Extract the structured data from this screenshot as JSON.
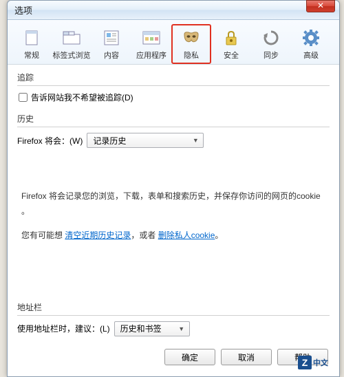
{
  "window": {
    "title": "选项",
    "close_glyph": "✕"
  },
  "toolbar": {
    "items": [
      {
        "label": "常规",
        "icon": "general"
      },
      {
        "label": "标签式浏览",
        "icon": "tabs"
      },
      {
        "label": "内容",
        "icon": "content"
      },
      {
        "label": "应用程序",
        "icon": "applications"
      },
      {
        "label": "隐私",
        "icon": "privacy",
        "active": true
      },
      {
        "label": "安全",
        "icon": "security"
      },
      {
        "label": "同步",
        "icon": "sync"
      },
      {
        "label": "高级",
        "icon": "advanced"
      }
    ]
  },
  "tracking": {
    "title": "追踪",
    "checkbox_label": "告诉网站我不希望被追踪(D)"
  },
  "history": {
    "title": "历史",
    "prefix": "Firefox 将会：(W)",
    "dropdown_value": "记录历史",
    "description_line1": "Firefox 将会记录您的浏览，下载，表单和搜索历史，并保存你访问的网页的cookie 。",
    "suggestion_prefix": "您有可能想 ",
    "link_clear": "清空近期历史记录",
    "suggestion_mid": "，或者 ",
    "link_delete": "删除私人cookie",
    "suggestion_suffix": "。"
  },
  "addressbar": {
    "title": "地址栏",
    "prefix": "使用地址栏时，建议：(L)",
    "dropdown_value": "历史和书签"
  },
  "buttons": {
    "ok": "确定",
    "cancel": "取消",
    "help": "帮助"
  },
  "watermark": {
    "z": "Z",
    "txt": "中文"
  }
}
